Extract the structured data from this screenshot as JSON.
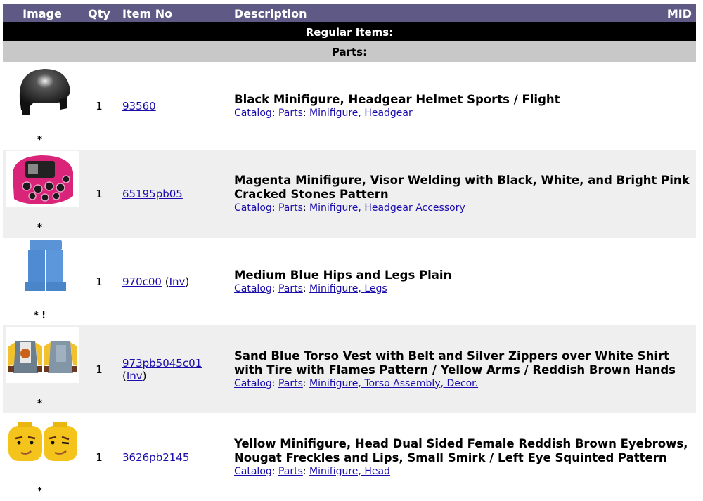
{
  "header": {
    "image": "Image",
    "qty": "Qty",
    "item_no": "Item No",
    "description": "Description",
    "mid": "MID"
  },
  "sections": {
    "regular": "Regular Items:",
    "parts": "Parts:"
  },
  "items": [
    {
      "icon": "black-sports-helmet-icon",
      "marker": "*",
      "qty": "1",
      "item_no": "93560",
      "inv": "",
      "title": "Black Minifigure, Headgear Helmet Sports / Flight",
      "catalog": "Catalog",
      "parts": "Parts",
      "category": "Minifigure, Headgear"
    },
    {
      "icon": "magenta-welding-visor-icon",
      "marker": "*",
      "qty": "1",
      "item_no": "65195pb05",
      "inv": "",
      "title": "Magenta Minifigure, Visor Welding with Black, White, and Bright Pink Cracked Stones Pattern",
      "catalog": "Catalog",
      "parts": "Parts",
      "category": "Minifigure, Headgear Accessory"
    },
    {
      "icon": "medium-blue-legs-icon",
      "marker": "* !",
      "qty": "1",
      "item_no": "970c00",
      "inv": "Inv",
      "title": "Medium Blue Hips and Legs Plain",
      "catalog": "Catalog",
      "parts": "Parts",
      "category": "Minifigure, Legs"
    },
    {
      "icon": "sand-blue-torso-icon",
      "marker": "*",
      "qty": "1",
      "item_no": "973pb5045c01",
      "inv": "Inv",
      "title": "Sand Blue Torso Vest with Belt and Silver Zippers over White Shirt with Tire with Flames Pattern / Yellow Arms / Reddish Brown Hands",
      "catalog": "Catalog",
      "parts": "Parts",
      "category": "Minifigure, Torso Assembly, Decor."
    },
    {
      "icon": "yellow-dual-sided-head-icon",
      "marker": "*",
      "qty": "1",
      "item_no": "3626pb2145",
      "inv": "",
      "title": "Yellow Minifigure, Head Dual Sided Female Reddish Brown Eyebrows, Nougat Freckles and Lips, Small Smirk / Left Eye Squinted Pattern",
      "catalog": "Catalog",
      "parts": "Parts",
      "category": "Minifigure, Head"
    }
  ]
}
